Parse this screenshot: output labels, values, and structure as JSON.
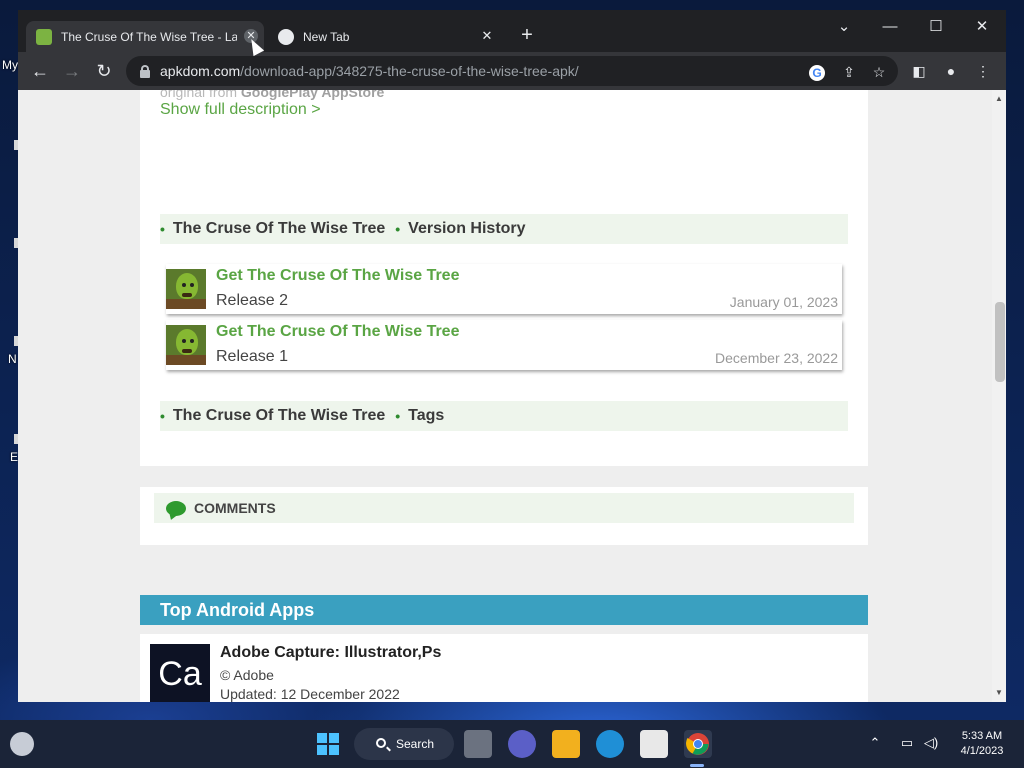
{
  "desktop": {
    "icon_labels": [
      "My",
      "N",
      "E"
    ]
  },
  "browser": {
    "tabs": [
      {
        "title": "The Cruse Of The Wise Tree - Lat",
        "active": true,
        "favicon": "android-icon"
      },
      {
        "title": "New Tab",
        "active": false,
        "favicon": "chrome-icon"
      }
    ],
    "new_tab_symbol": "+",
    "window_controls": {
      "dropdown": "⌄",
      "minimize": "—",
      "maximize": "☐",
      "close": "✕"
    },
    "nav": {
      "back": "←",
      "forward": "→",
      "reload": "↻"
    },
    "address": {
      "host": "apkdom.com",
      "path": "/download-app/348275-the-cruse-of-the-wise-tree-apk/"
    }
  },
  "page": {
    "faded_text_prefix": "original from ",
    "faded_text_bold": "GooglePlay AppStore",
    "show_full_description": "Show full description >",
    "version_history_bar": {
      "app_name": "The Cruse Of The Wise Tree",
      "section": "Version History"
    },
    "releases": [
      {
        "title": "Get The Cruse Of The Wise Tree",
        "label": "Release 2",
        "date": "January 01, 2023"
      },
      {
        "title": "Get The Cruse Of The Wise Tree",
        "label": "Release 1",
        "date": "December 23, 2022"
      }
    ],
    "tags_bar": {
      "app_name": "The Cruse Of The Wise Tree",
      "section": "Tags"
    },
    "comments_label": "COMMENTS",
    "top_apps_title": "Top Android Apps",
    "top_apps": [
      {
        "icon_text": "Ca",
        "name": "Adobe Capture: Illustrator,Ps",
        "developer": "© Adobe",
        "updated": "Updated: 12 December 2022"
      }
    ]
  },
  "taskbar": {
    "search_label": "Search",
    "time": "5:33 AM",
    "date": "4/1/2023",
    "apps": [
      "start-icon",
      "search",
      "task-view-icon",
      "chat-icon",
      "file-explorer-icon",
      "edge-icon",
      "store-icon",
      "chrome-icon"
    ]
  },
  "colors": {
    "accent_green": "#5aa544",
    "section_bg": "#eef5ec",
    "top_apps_blue": "#3aa0c0"
  }
}
